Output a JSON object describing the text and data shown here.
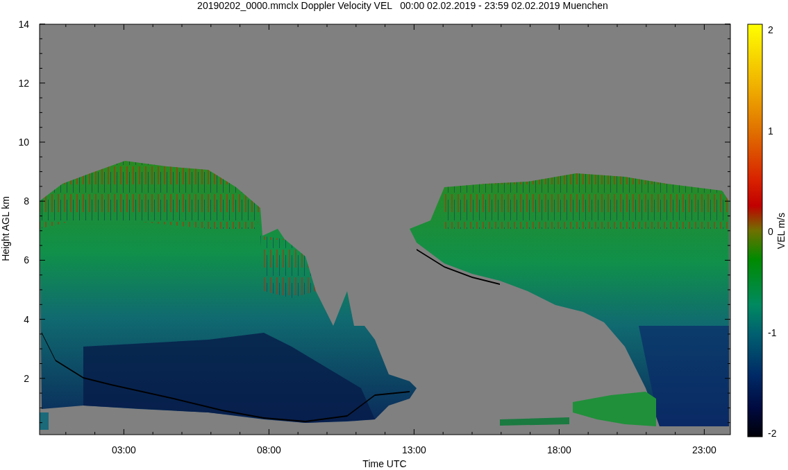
{
  "title": "20190202_0000.mmclx Doppler Velocity VEL   00:00 02.02.2019 - 23:59 02.02.2019 Muenchen",
  "y_axis": {
    "label": "Height AGL km",
    "ticks": [
      "14",
      "12",
      "10",
      "8",
      "6",
      "4",
      "2"
    ]
  },
  "x_axis": {
    "label": "Time UTC",
    "ticks": [
      "03:00",
      "08:00",
      "13:00",
      "18:00",
      "23:00"
    ]
  },
  "colorbar": {
    "label": "VEL m/s",
    "ticks": [
      "2",
      "1",
      "0",
      "-1",
      "-2"
    ]
  }
}
